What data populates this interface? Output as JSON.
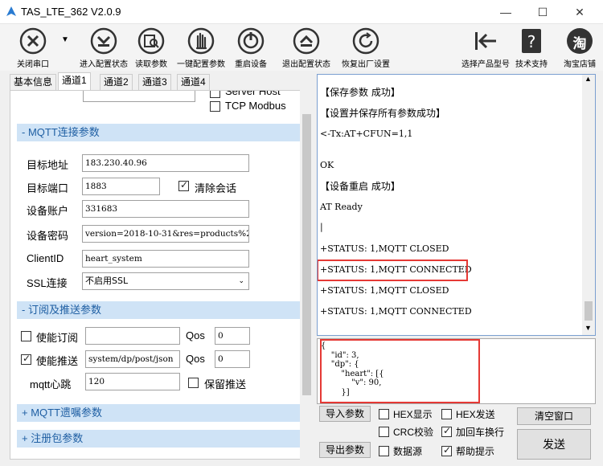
{
  "window": {
    "title": "TAS_LTE_362 V2.0.9"
  },
  "toolbar": [
    {
      "label": "关闭串口"
    },
    {
      "label": "进入配置状态"
    },
    {
      "label": "读取参数"
    },
    {
      "label": "一键配置参数"
    },
    {
      "label": "重启设备"
    },
    {
      "label": "退出配置状态"
    },
    {
      "label": "恢复出厂设置"
    },
    {
      "label": "选择产品型号"
    },
    {
      "label": "技术支持"
    },
    {
      "label": "淘宝店铺"
    }
  ],
  "taobao_char": "淘",
  "tabs": [
    "基本信息",
    "通道1",
    "通道2",
    "通道3",
    "通道4"
  ],
  "top_partial": {
    "server_host": "Server Host",
    "tcp_modbus": "TCP Modbus"
  },
  "mqtt": {
    "section": "- MQTT连接参数",
    "addr_label": "目标地址",
    "addr": "183.230.40.96",
    "port_label": "目标端口",
    "port": "1883",
    "clean_label": "清除会话",
    "account_label": "设备账户",
    "account": "331683",
    "pwd_label": "设备密码",
    "pwd": "version=2018-10-31&res=products%2",
    "cid_label": "ClientID",
    "cid": "heart_system",
    "ssl_label": "SSL连接",
    "ssl": "不启用SSL"
  },
  "sub": {
    "section": "- 订阅及推送参数",
    "sub_label": "使能订阅",
    "sub_val": "",
    "qos_label": "Qos",
    "sub_qos": "0",
    "pub_label": "使能推送",
    "pub_val": "system/dp/post/json",
    "pub_qos": "0",
    "hb_label": "mqtt心跳",
    "hb": "120",
    "keep_label": "保留推送"
  },
  "will_section": "+ MQTT遗嘱参数",
  "reg_section": "+ 注册包参数",
  "log": [
    "【保存参数 成功】",
    "【设置并保存所有参数成功】",
    "<-Tx:AT+CFUN=1,1",
    "",
    "OK",
    "【设备重启 成功】",
    "AT Ready",
    "|",
    "+STATUS: 1,MQTT CLOSED",
    "+STATUS: 1,MQTT CONNECTED",
    "+STATUS: 1,MQTT CLOSED",
    "+STATUS: 1,MQTT CONNECTED"
  ],
  "send_text": "{\n    \"id\": 3,\n    \"dp\": {\n        \"heart\": [{\n            \"v\": 90,\n        }]",
  "bottom": {
    "import": "导入参数",
    "export": "导出参数",
    "hex_show": "HEX显示",
    "hex_send": "HEX发送",
    "crc": "CRC校验",
    "crlf": "加回车换行",
    "datasrc": "数据源",
    "help": "帮助提示",
    "clear": "清空窗口",
    "send": "发送"
  }
}
